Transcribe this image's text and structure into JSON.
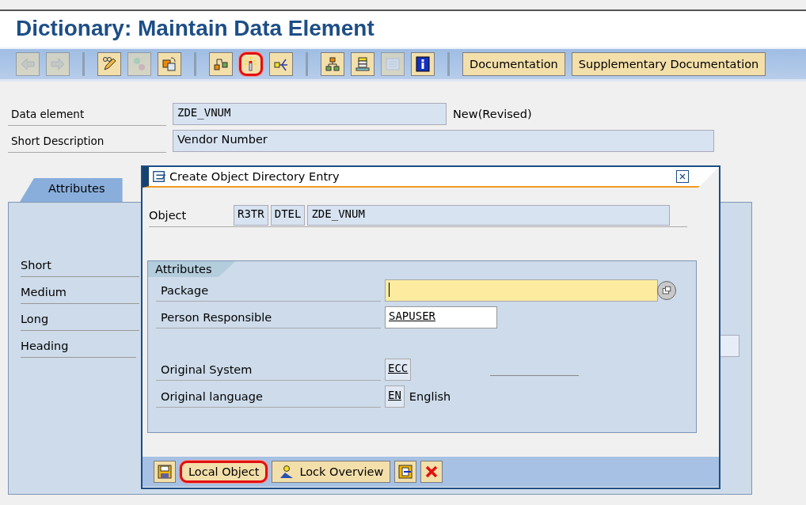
{
  "window": {
    "title": "Dictionary: Maintain Data Element"
  },
  "toolbar": [
    {
      "kind": "icon",
      "disabled": true,
      "highlighted": false
    },
    {
      "kind": "icon",
      "disabled": true,
      "highlighted": false
    },
    {
      "kind": "separator"
    },
    {
      "kind": "icon",
      "disabled": false,
      "highlighted": false
    },
    {
      "kind": "icon",
      "disabled": true,
      "highlighted": false
    },
    {
      "kind": "icon",
      "disabled": false,
      "highlighted": false
    },
    {
      "kind": "separator"
    },
    {
      "kind": "icon",
      "disabled": false,
      "highlighted": false
    },
    {
      "kind": "icon",
      "disabled": false,
      "highlighted": true
    },
    {
      "kind": "icon",
      "disabled": false,
      "highlighted": false
    },
    {
      "kind": "separator"
    },
    {
      "kind": "icon",
      "disabled": false,
      "highlighted": false
    },
    {
      "kind": "icon",
      "disabled": false,
      "highlighted": false
    },
    {
      "kind": "icon",
      "disabled": true,
      "highlighted": false
    },
    {
      "kind": "icon",
      "disabled": false,
      "highlighted": false
    },
    {
      "kind": "separator"
    },
    {
      "kind": "text",
      "label": "Documentation",
      "highlighted": false
    },
    {
      "kind": "text",
      "label": "Supplementary Documentation",
      "highlighted": false
    }
  ],
  "header": {
    "data_element": {
      "label": "Data element",
      "value": "ZDE_VNUM",
      "status": "New(Revised)"
    },
    "short_description": {
      "label": "Short Description",
      "value": "Vendor Number"
    }
  },
  "tabs": [
    {
      "label": "Attributes",
      "selected": true
    }
  ],
  "field_labels": [
    "Short",
    "Medium",
    "Long",
    "Heading"
  ],
  "dialog": {
    "title": "Create Object Directory Entry",
    "object": {
      "label": "Object",
      "parts": [
        "R3TR",
        "DTEL",
        "ZDE_VNUM"
      ]
    },
    "group": {
      "title": "Attributes",
      "fields": [
        {
          "kind": "input",
          "label": "Package",
          "required": true,
          "focused": true
        },
        {
          "kind": "input",
          "label": "Person Responsible",
          "value": "SAPUSER",
          "required": false,
          "focused": false
        },
        {
          "kind": "gap"
        },
        {
          "kind": "display",
          "label": "Original System",
          "value": "ECC"
        },
        {
          "kind": "display",
          "label": "Original language",
          "value": "EN",
          "text": "English"
        }
      ]
    },
    "buttons": [
      {
        "kind": "icon",
        "highlighted": false
      },
      {
        "kind": "text",
        "label": "Local Object",
        "highlighted": true
      },
      {
        "kind": "text",
        "label": "Lock Overview",
        "highlighted": false
      },
      {
        "kind": "icon",
        "highlighted": false
      },
      {
        "kind": "icon",
        "highlighted": false
      }
    ]
  }
}
